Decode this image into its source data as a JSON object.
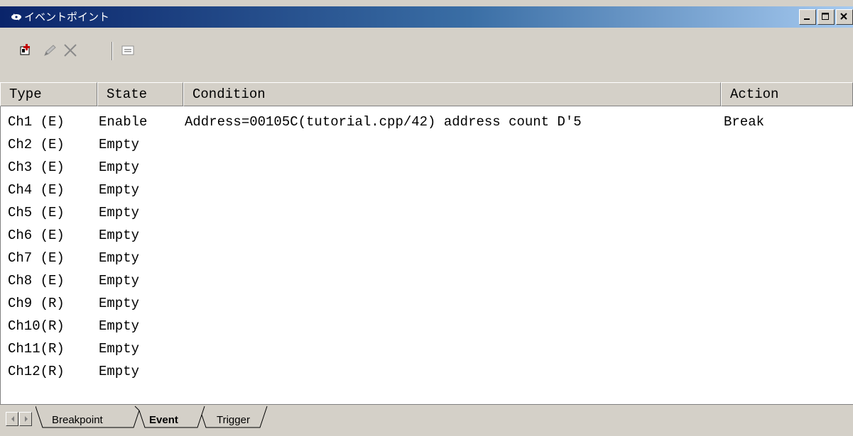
{
  "window": {
    "title": "イベントポイント",
    "title_icon": "event-point-icon"
  },
  "title_buttons": {
    "minimize_icon": "minimize-icon",
    "maximize_icon": "maximize-icon",
    "close_icon": "close-icon"
  },
  "toolbar": {
    "tools": [
      {
        "name": "add-icon",
        "enabled": true
      },
      {
        "name": "edit-icon",
        "enabled": false
      },
      {
        "name": "delete-icon",
        "enabled": false
      },
      {
        "name": "properties-icon",
        "enabled": false
      }
    ]
  },
  "columns": [
    "Type",
    "State",
    "Condition",
    "Action"
  ],
  "rows": [
    {
      "type": "Ch1 (E)",
      "state": "Enable",
      "condition": "Address=00105C(tutorial.cpp/42) address count D'5",
      "action": "Break"
    },
    {
      "type": "Ch2 (E)",
      "state": "Empty",
      "condition": "",
      "action": ""
    },
    {
      "type": "Ch3 (E)",
      "state": "Empty",
      "condition": "",
      "action": ""
    },
    {
      "type": "Ch4 (E)",
      "state": "Empty",
      "condition": "",
      "action": ""
    },
    {
      "type": "Ch5 (E)",
      "state": "Empty",
      "condition": "",
      "action": ""
    },
    {
      "type": "Ch6 (E)",
      "state": "Empty",
      "condition": "",
      "action": ""
    },
    {
      "type": "Ch7 (E)",
      "state": "Empty",
      "condition": "",
      "action": ""
    },
    {
      "type": "Ch8 (E)",
      "state": "Empty",
      "condition": "",
      "action": ""
    },
    {
      "type": "Ch9 (R)",
      "state": "Empty",
      "condition": "",
      "action": ""
    },
    {
      "type": "Ch10(R)",
      "state": "Empty",
      "condition": "",
      "action": ""
    },
    {
      "type": "Ch11(R)",
      "state": "Empty",
      "condition": "",
      "action": ""
    },
    {
      "type": "Ch12(R)",
      "state": "Empty",
      "condition": "",
      "action": ""
    }
  ],
  "tabs": {
    "items": [
      "Breakpoint",
      "Event",
      "Trigger"
    ],
    "active": "Event",
    "scroll_left_icon": "scroll-left-icon",
    "scroll_right_icon": "scroll-right-icon"
  },
  "colors": {
    "title_start": "#0a246a",
    "title_end": "#a6caf0",
    "face": "#d4d0c8"
  }
}
